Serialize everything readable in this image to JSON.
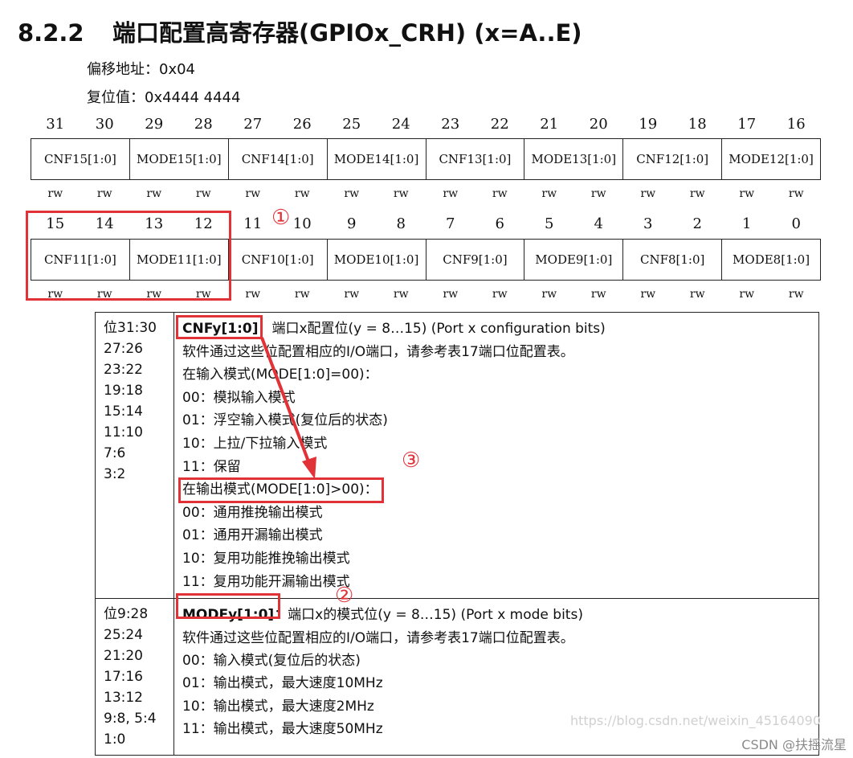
{
  "heading": {
    "number": "8.2.2",
    "text": "端口配置高寄存器(GPIOx_CRH) (x=A..E)"
  },
  "offset": "偏移地址：0x04",
  "reset": "复位值：0x4444 4444",
  "bits_high": [
    "31",
    "30",
    "29",
    "28",
    "27",
    "26",
    "25",
    "24",
    "23",
    "22",
    "21",
    "20",
    "19",
    "18",
    "17",
    "16"
  ],
  "fields_high": [
    "CNF15[1:0]",
    "MODE15[1:0]",
    "CNF14[1:0]",
    "MODE14[1:0]",
    "CNF13[1:0]",
    "MODE13[1:0]",
    "CNF12[1:0]",
    "MODE12[1:0]"
  ],
  "rw": [
    "rw",
    "rw",
    "rw",
    "rw",
    "rw",
    "rw",
    "rw",
    "rw",
    "rw",
    "rw",
    "rw",
    "rw",
    "rw",
    "rw",
    "rw",
    "rw"
  ],
  "bits_low": [
    "15",
    "14",
    "13",
    "12",
    "11",
    "10",
    "9",
    "8",
    "7",
    "6",
    "5",
    "4",
    "3",
    "2",
    "1",
    "0"
  ],
  "fields_low": [
    "CNF11[1:0]",
    "MODE11[1:0]",
    "CNF10[1:0]",
    "MODE10[1:0]",
    "CNF9[1:0]",
    "MODE9[1:0]",
    "CNF8[1:0]",
    "MODE8[1:0]"
  ],
  "annotations": {
    "one": "①",
    "two": "②",
    "three": "③"
  },
  "cnf": {
    "bits": [
      "位31:30",
      "27:26",
      "23:22",
      "19:18",
      "15:14",
      "11:10",
      "7:6",
      "3:2"
    ],
    "name": "CNFy[1:0]",
    "title_rest": "：端口x配置位(y = 8…15) (Port x configuration bits)",
    "lines": [
      "软件通过这些位配置相应的I/O端口，请参考表17端口位配置表。",
      "在输入模式(MODE[1:0]=00)：",
      "00：模拟输入模式",
      "01：浮空输入模式(复位后的状态)",
      "10：上拉/下拉输入模式",
      "11：保留",
      "在输出模式(MODE[1:0]>00)：",
      "00：通用推挽输出模式",
      "01：通用开漏输出模式",
      "10：复用功能推挽输出模式",
      "11：复用功能开漏输出模式"
    ]
  },
  "mode": {
    "bits": [
      "位9:28",
      "25:24",
      "21:20",
      "17:16",
      "13:12",
      "9:8, 5:4",
      "1:0"
    ],
    "name": "MODEy[1:0]",
    "title_rest": "：端口x的模式位(y = 8…15) (Port x mode bits)",
    "lines": [
      "软件通过这些位配置相应的I/O端口，请参考表17端口位配置表。",
      "00：输入模式(复位后的状态)",
      "01：输出模式，最大速度10MHz",
      "10：输出模式，最大速度2MHz",
      "11：输出模式，最大速度50MHz"
    ]
  },
  "watermark": "https://blog.csdn.net/weixin_45164090",
  "csdn_credit": "CSDN @扶摇流星",
  "colors": {
    "annotation_red": "#e13238",
    "border": "#222222"
  }
}
